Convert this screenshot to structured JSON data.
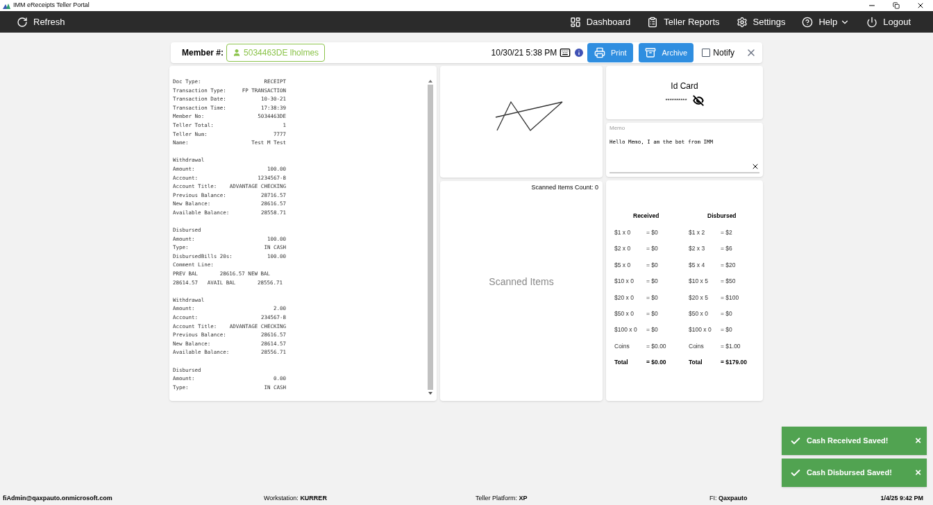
{
  "window": {
    "title": "IMM eReceipts Teller Portal"
  },
  "nav": {
    "refresh": "Refresh",
    "items": [
      {
        "kind": "dashboard",
        "label": "Dashboard"
      },
      {
        "kind": "reports",
        "label": "Teller Reports"
      },
      {
        "kind": "settings",
        "label": "Settings"
      },
      {
        "kind": "help",
        "label": "Help"
      },
      {
        "kind": "logout",
        "label": "Logout"
      }
    ]
  },
  "toolbar": {
    "member_label": "Member #:",
    "member": "5034463DE lholmes",
    "datetime": "10/30/21 5:38 PM",
    "print": "Print",
    "archive": "Archive",
    "notify": {
      "label": "Notify",
      "checked": false
    }
  },
  "receipt": {
    "sections": [
      {
        "lines": [
          {
            "label": "Doc Type:",
            "value": "RECEIPT"
          },
          {
            "label": "Transaction Type:",
            "value": "FP TRANSACTION"
          },
          {
            "label": "Transaction Date:",
            "value": "10-30-21"
          },
          {
            "label": "Transaction Time:",
            "value": "17:38:39"
          },
          {
            "label": "Member No:",
            "value": "5034463DE"
          },
          {
            "label": "Teller Total:",
            "value": "1"
          },
          {
            "label": "Teller Num:",
            "value": "7777"
          },
          {
            "label": "Name:",
            "value": "Test M Test"
          }
        ]
      },
      {
        "heading": "Withdrawal",
        "lines": [
          {
            "label": "Amount:",
            "value": "100.00"
          },
          {
            "label": "Account:",
            "value": "1234567-8"
          },
          {
            "label": "Account Title:",
            "value": "ADVANTAGE CHECKING"
          },
          {
            "label": "Previous Balance:",
            "value": "28716.57"
          },
          {
            "label": "New Balance:",
            "value": "28616.57"
          },
          {
            "label": "Available Balance:",
            "value": "28558.71"
          }
        ]
      },
      {
        "heading": "Disbursed",
        "lines": [
          {
            "label": "Amount:",
            "value": "100.00"
          },
          {
            "label": "Type:",
            "value": "IN CASH"
          },
          {
            "label": "DisbursedBills 20s:",
            "value": "100.00"
          },
          {
            "label": "Comment Line:"
          },
          {
            "label": "PREV BAL       28616.57 NEW BAL"
          },
          {
            "label": "28614.57   AVAIL BAL       28556.71"
          }
        ]
      },
      {
        "heading": "Withdrawal",
        "lines": [
          {
            "label": "Amount:",
            "value": "2.00"
          },
          {
            "label": "Account:",
            "value": "234567-8"
          },
          {
            "label": "Account Title:",
            "value": "ADVANTAGE CHECKING"
          },
          {
            "label": "Previous Balance:",
            "value": "28616.57"
          },
          {
            "label": "New Balance:",
            "value": "28614.57"
          },
          {
            "label": "Available Balance:",
            "value": "28556.71"
          }
        ]
      },
      {
        "heading": "Disbursed",
        "lines": [
          {
            "label": "Amount:",
            "value": "0.00"
          },
          {
            "label": "Type:",
            "value": "IN CASH"
          }
        ]
      }
    ]
  },
  "scanned": {
    "count": "Scanned Items Count: 0",
    "empty": "Scanned Items"
  },
  "id_card": {
    "title": "Id Card",
    "masked": "**********"
  },
  "memo": {
    "label": "Memo",
    "value": "Hello Memo, I am the bot from IMM"
  },
  "cash": {
    "columns": [
      {
        "heading": "Received",
        "rows": [
          {
            "kind": "item",
            "qty": "$1 x 0",
            "sum": "= $0"
          },
          {
            "kind": "item",
            "qty": "$2 x 0",
            "sum": "= $0"
          },
          {
            "kind": "item",
            "qty": "$5 x 0",
            "sum": "= $0"
          },
          {
            "kind": "item",
            "qty": "$10 x 0",
            "sum": "= $0"
          },
          {
            "kind": "item",
            "qty": "$20 x 0",
            "sum": "= $0"
          },
          {
            "kind": "item",
            "qty": "$50 x 0",
            "sum": "= $0"
          },
          {
            "kind": "item",
            "qty": "$100 x 0",
            "sum": "= $0"
          },
          {
            "kind": "item",
            "qty": "Coins",
            "sum": "= $0.00"
          },
          {
            "kind": "total",
            "qty": "Total",
            "sum": "= $0.00"
          }
        ]
      },
      {
        "heading": "Disbursed",
        "rows": [
          {
            "kind": "item",
            "qty": "$1 x 2",
            "sum": "= $2"
          },
          {
            "kind": "item",
            "qty": "$2 x 3",
            "sum": "= $6"
          },
          {
            "kind": "item",
            "qty": "$5 x 4",
            "sum": "= $20"
          },
          {
            "kind": "item",
            "qty": "$10 x 5",
            "sum": "= $50"
          },
          {
            "kind": "item",
            "qty": "$20 x 5",
            "sum": "= $100"
          },
          {
            "kind": "item",
            "qty": "$50 x 0",
            "sum": "= $0"
          },
          {
            "kind": "item",
            "qty": "$100 x 0",
            "sum": "= $0"
          },
          {
            "kind": "item",
            "qty": "Coins",
            "sum": "= $1.00"
          },
          {
            "kind": "total",
            "qty": "Total",
            "sum": "= $179.00"
          }
        ]
      }
    ]
  },
  "toasts": [
    {
      "text": "Cash Received Saved!",
      "close": "×"
    },
    {
      "text": "Cash Disbursed Saved!",
      "close": "×"
    }
  ],
  "status_bar": {
    "user": "fiAdmin@qaxpauto.onmicrosoft.com",
    "items": [
      {
        "label": "Workstation:",
        "value": "KURRER"
      },
      {
        "label": "Teller Platform:",
        "value": "XP"
      },
      {
        "label": "FI:",
        "value": "Qaxpauto"
      }
    ],
    "datetime": "1/4/25 9:42 PM"
  }
}
